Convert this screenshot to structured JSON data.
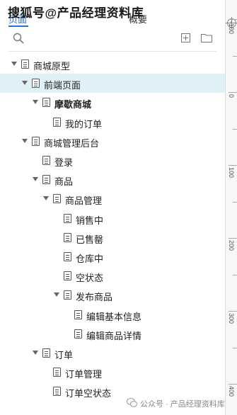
{
  "watermark_top": "搜狐号@产品经理资料库",
  "watermark_bottom": "公众号 · 产品经理资料库",
  "tabs": [
    {
      "label": "页面",
      "active": true
    },
    {
      "label": "概要",
      "active": false
    }
  ],
  "toolbar": {
    "search_icon": "search-icon",
    "add_icon": "add-page-icon",
    "folder_icon": "folder-icon"
  },
  "tree": [
    {
      "label": "商城原型",
      "depth": 0,
      "caret": true,
      "bold": false,
      "selected": false
    },
    {
      "label": "前端页面",
      "depth": 1,
      "caret": true,
      "bold": false,
      "selected": true
    },
    {
      "label": "摩歇商城",
      "depth": 2,
      "caret": true,
      "bold": true,
      "selected": false
    },
    {
      "label": "我的订单",
      "depth": 3,
      "caret": false,
      "bold": false,
      "selected": false
    },
    {
      "label": "商城管理后台",
      "depth": 1,
      "caret": true,
      "bold": false,
      "selected": false
    },
    {
      "label": "登录",
      "depth": 2,
      "caret": false,
      "bold": false,
      "selected": false
    },
    {
      "label": "商品",
      "depth": 2,
      "caret": true,
      "bold": false,
      "selected": false
    },
    {
      "label": "商品管理",
      "depth": 3,
      "caret": true,
      "bold": false,
      "selected": false
    },
    {
      "label": "销售中",
      "depth": 4,
      "caret": false,
      "bold": false,
      "selected": false
    },
    {
      "label": "已售罄",
      "depth": 4,
      "caret": false,
      "bold": false,
      "selected": false
    },
    {
      "label": "仓库中",
      "depth": 4,
      "caret": false,
      "bold": false,
      "selected": false
    },
    {
      "label": "空状态",
      "depth": 4,
      "caret": false,
      "bold": false,
      "selected": false
    },
    {
      "label": "发布商品",
      "depth": 4,
      "caret": true,
      "bold": false,
      "selected": false
    },
    {
      "label": "编辑基本信息",
      "depth": 5,
      "caret": false,
      "bold": false,
      "selected": false
    },
    {
      "label": "编辑商品详情",
      "depth": 5,
      "caret": false,
      "bold": false,
      "selected": false
    },
    {
      "label": "订单",
      "depth": 2,
      "caret": true,
      "bold": false,
      "selected": false
    },
    {
      "label": "订单管理",
      "depth": 3,
      "caret": false,
      "bold": false,
      "selected": false
    },
    {
      "label": "订单空状态",
      "depth": 3,
      "caret": false,
      "bold": false,
      "selected": false
    }
  ],
  "ruler": {
    "labels": [
      "-100",
      "0",
      "100",
      "200",
      "300",
      "400"
    ]
  }
}
